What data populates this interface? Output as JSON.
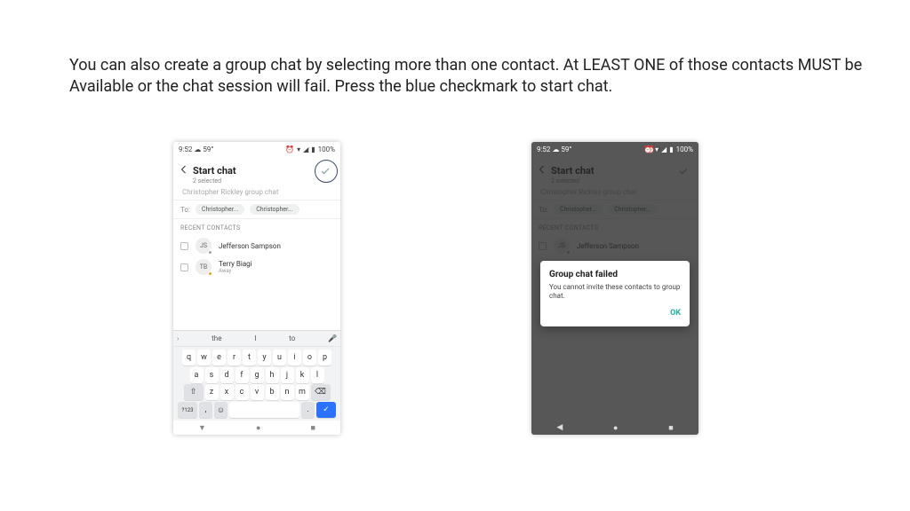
{
  "doc": {
    "paragraph": "You can also create a group chat by selecting more than one contact.  At LEAST ONE of those contacts MUST be Available or the chat session will fail.  Press the blue checkmark to start chat."
  },
  "left": {
    "status": {
      "time": "9:52",
      "temp": "59°",
      "battery": "100%"
    },
    "header": {
      "title": "Start chat",
      "subtitle": "2 selected"
    },
    "group_name": "Christopher Rickley group chat",
    "to": {
      "label": "To:",
      "chips": [
        "Christopher...",
        "Christopher..."
      ]
    },
    "section": "RECENT CONTACTS",
    "contacts": [
      {
        "initials": "JS",
        "name": "Jefferson Sampson",
        "status": "",
        "dot": "#9aa"
      },
      {
        "initials": "TB",
        "name": "Terry Biagi",
        "status": "Away",
        "dot": "#f0a020"
      }
    ],
    "keyboard": {
      "suggestions": [
        "the",
        "I",
        "to"
      ],
      "rows": [
        [
          "q",
          "w",
          "e",
          "r",
          "t",
          "y",
          "u",
          "i",
          "o",
          "p"
        ],
        [
          "a",
          "s",
          "d",
          "f",
          "g",
          "h",
          "j",
          "k",
          "l"
        ],
        [
          "⇧",
          "z",
          "x",
          "c",
          "v",
          "b",
          "n",
          "m",
          "⌫"
        ],
        [
          "?123",
          ",",
          "☺",
          " ",
          ".",
          "✓"
        ]
      ]
    }
  },
  "right": {
    "status": {
      "time": "9:52",
      "temp": "59°",
      "battery": "100%"
    },
    "header": {
      "title": "Start chat",
      "subtitle": "2 selected"
    },
    "group_name": "Christopher Rickley group chat",
    "to": {
      "label": "To:",
      "chips": [
        "Christopher...",
        "Christopher..."
      ]
    },
    "section": "RECENT CONTACTS",
    "contacts": [
      {
        "initials": "JS",
        "name": "Jefferson Sampson",
        "status": "",
        "dot": "#9aa"
      }
    ],
    "dialog": {
      "title": "Group chat failed",
      "message": "You cannot invite these contacts to group chat.",
      "ok": "OK"
    }
  }
}
